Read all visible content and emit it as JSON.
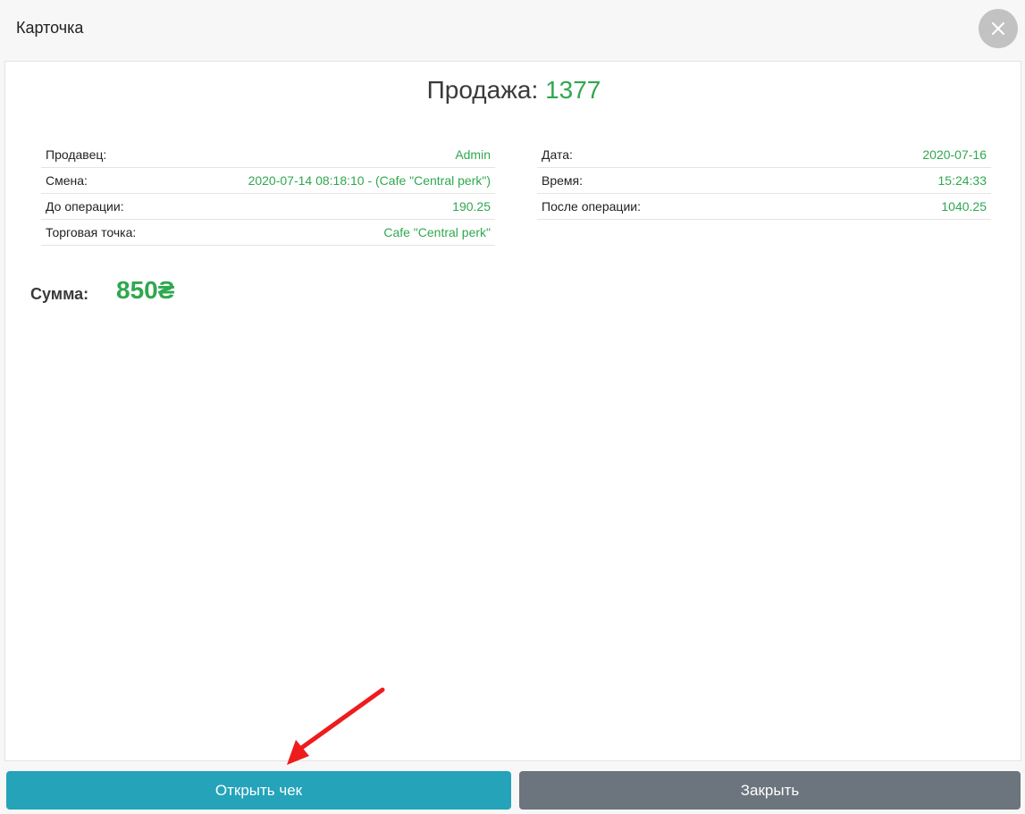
{
  "modal": {
    "title": "Карточка"
  },
  "sale": {
    "label": "Продажа:",
    "number": "1377"
  },
  "info_left": [
    {
      "label": "Продавец:",
      "value": "Admin"
    },
    {
      "label": "Смена:",
      "value": "2020-07-14 08:18:10 - (Cafe \"Central perk\")"
    },
    {
      "label": "До операции:",
      "value": "190.25"
    },
    {
      "label": "Торговая точка:",
      "value": "Cafe \"Central perk\""
    }
  ],
  "info_right": [
    {
      "label": "Дата:",
      "value": "2020-07-16"
    },
    {
      "label": "Время:",
      "value": "15:24:33"
    },
    {
      "label": "После операции:",
      "value": "1040.25"
    }
  ],
  "sum": {
    "label": "Сумма:",
    "value": "850₴"
  },
  "buttons": {
    "open_receipt": "Открыть чек",
    "close": "Закрыть"
  },
  "icons": {
    "close": "close-icon",
    "annotation": "red-arrow"
  },
  "colors": {
    "accent_green": "#2fa84f",
    "primary_button": "#24a3b9",
    "secondary_button": "#6c757d",
    "annotation_red": "#ee1c1c"
  }
}
